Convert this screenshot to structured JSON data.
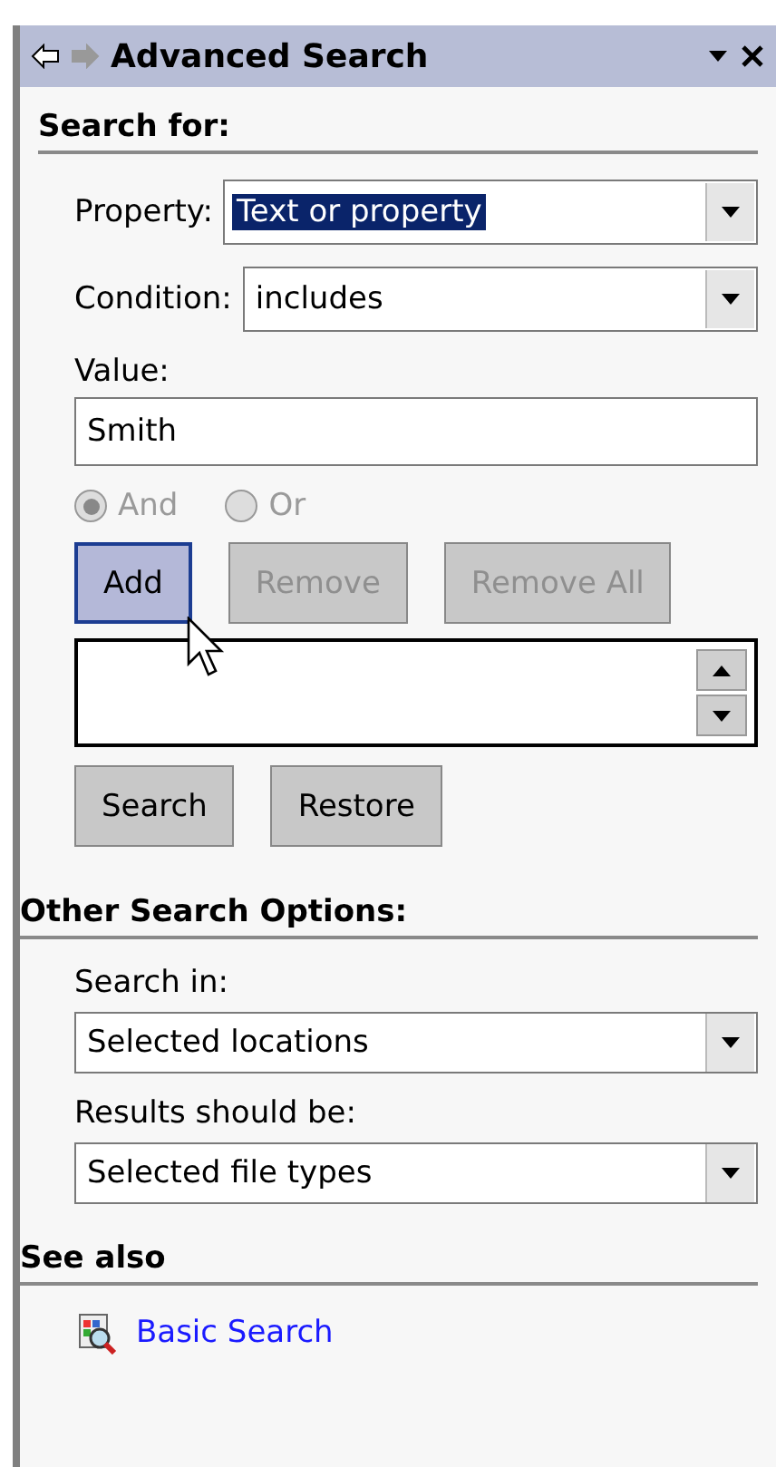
{
  "header": {
    "title": "Advanced Search",
    "back_enabled": true,
    "forward_enabled": false
  },
  "search_for": {
    "heading": "Search for:",
    "property": {
      "label": "Property:",
      "value": "Text or property",
      "text_selected": true
    },
    "condition": {
      "label": "Condition:",
      "value": "includes"
    },
    "value": {
      "label": "Value:",
      "value": "Smith"
    },
    "logic": [
      {
        "label": "And",
        "selected": true,
        "disabled": true
      },
      {
        "label": "Or",
        "selected": false,
        "disabled": true
      }
    ],
    "buttons": [
      {
        "label": "Add",
        "disabled": false,
        "hovered": true
      },
      {
        "label": "Remove",
        "disabled": true,
        "hovered": false
      },
      {
        "label": "Remove All",
        "disabled": true,
        "hovered": false
      }
    ],
    "actions": [
      {
        "label": "Search"
      },
      {
        "label": "Restore"
      }
    ]
  },
  "other_options": {
    "heading": "Other Search Options:",
    "fields": [
      {
        "label": "Search in:",
        "value": "Selected locations"
      },
      {
        "label": "Results should be:",
        "value": "Selected file types"
      }
    ]
  },
  "see_also": {
    "heading": "See also",
    "links": [
      {
        "label": "Basic Search"
      }
    ]
  }
}
